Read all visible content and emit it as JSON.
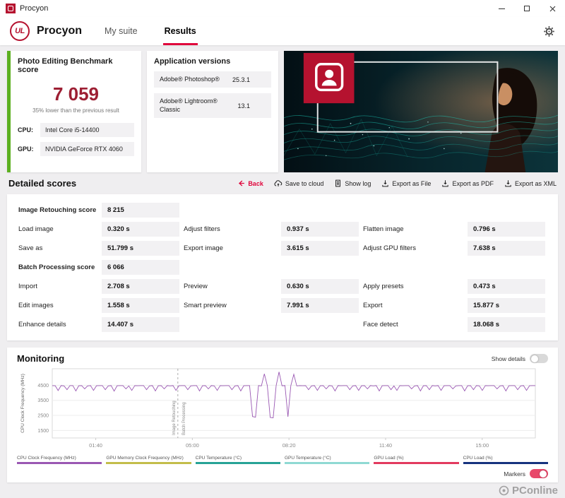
{
  "window": {
    "title": "Procyon"
  },
  "header": {
    "brand": "Procyon",
    "tabs": [
      {
        "label": "My suite",
        "active": false
      },
      {
        "label": "Results",
        "active": true
      }
    ]
  },
  "score_card": {
    "title": "Photo Editing Benchmark score",
    "score": "7 059",
    "comparison": "35% lower than the previous result",
    "accent_green": "#5cb020",
    "score_color": "#9d1f33",
    "specs": [
      {
        "label": "CPU:",
        "value": "Intel Core i5-14400"
      },
      {
        "label": "GPU:",
        "value": "NVIDIA GeForce RTX 4060"
      }
    ]
  },
  "app_versions": {
    "title": "Application versions",
    "rows": [
      {
        "name": "Adobe® Photoshop®",
        "version": "25.3.1"
      },
      {
        "name": "Adobe® Lightroom® Classic",
        "version": "13.1"
      }
    ]
  },
  "toolbar": {
    "section_title": "Detailed scores",
    "buttons": [
      {
        "label": "Back",
        "icon": "back-arrow-icon",
        "accent": true
      },
      {
        "label": "Save to cloud",
        "icon": "cloud-upload-icon",
        "accent": false
      },
      {
        "label": "Show log",
        "icon": "log-icon",
        "accent": false
      },
      {
        "label": "Export as File",
        "icon": "export-file-icon",
        "accent": false
      },
      {
        "label": "Export as PDF",
        "icon": "export-pdf-icon",
        "accent": false
      },
      {
        "label": "Export as XML",
        "icon": "export-xml-icon",
        "accent": false
      }
    ]
  },
  "detailed_scores": {
    "rows": [
      [
        {
          "label": "Image Retouching score",
          "value": "8 215",
          "bold": true
        },
        null,
        null
      ],
      [
        {
          "label": "Load image",
          "value": "0.320 s"
        },
        {
          "label": "Adjust filters",
          "value": "0.937 s"
        },
        {
          "label": "Flatten image",
          "value": "0.796 s"
        }
      ],
      [
        {
          "label": "Save as",
          "value": "51.799 s"
        },
        {
          "label": "Export image",
          "value": "3.615 s"
        },
        {
          "label": "Adjust GPU filters",
          "value": "7.638 s"
        }
      ],
      [
        {
          "label": "Batch Processing score",
          "value": "6 066",
          "bold": true
        },
        null,
        null
      ],
      [
        {
          "label": "Import",
          "value": "2.708 s"
        },
        {
          "label": "Preview",
          "value": "0.630 s"
        },
        {
          "label": "Apply presets",
          "value": "0.473 s"
        }
      ],
      [
        {
          "label": "Edit images",
          "value": "1.558 s"
        },
        {
          "label": "Smart preview",
          "value": "7.991 s"
        },
        {
          "label": "Export",
          "value": "15.877 s"
        }
      ],
      [
        {
          "label": "Enhance details",
          "value": "14.407 s"
        },
        null,
        {
          "label": "Face detect",
          "value": "18.068 s"
        }
      ]
    ]
  },
  "monitoring": {
    "title": "Monitoring",
    "show_details_label": "Show details",
    "show_details_on": false,
    "markers_label": "Markers",
    "markers_on": true,
    "legend": [
      {
        "label": "CPU Clock Frequency (MHz)",
        "color": "#9a58b3"
      },
      {
        "label": "GPU Memory Clock Frequency (MHz)",
        "color": "#c3bd4a"
      },
      {
        "label": "CPU Temperature (°C)",
        "color": "#27a396"
      },
      {
        "label": "GPU Temperature (°C)",
        "color": "#8fd9d3"
      },
      {
        "label": "GPU Load (%)",
        "color": "#e23a5f"
      },
      {
        "label": "CPU Load (%)",
        "color": "#16337e"
      }
    ]
  },
  "chart_data": {
    "type": "line",
    "title": "Monitoring",
    "ylabel": "CPU Clock Frequency (MHz)",
    "xlabel": "",
    "grid": true,
    "legend_position": "bottom",
    "x_ticks": [
      "01:40",
      "05:00",
      "08:20",
      "11:40",
      "15:00"
    ],
    "x_tick_positions": [
      0.09,
      0.29,
      0.49,
      0.69,
      0.89
    ],
    "y_ticks": [
      1500,
      2500,
      3500,
      4500
    ],
    "ylim": [
      1000,
      5600
    ],
    "markers": [
      {
        "position": 0.26,
        "left_label": "Image Retouching",
        "right_label": "Batch Processing"
      }
    ],
    "series": [
      {
        "name": "CPU Clock Frequency (MHz)",
        "color": "#9a58b3",
        "values": [
          4480,
          4470,
          4150,
          4480,
          4460,
          4210,
          4480,
          4480,
          4120,
          4470,
          4480,
          4260,
          4460,
          4480,
          4160,
          4470,
          4480,
          4480,
          4210,
          4460,
          4480,
          4110,
          4470,
          4480,
          4480,
          4260,
          4460,
          4160,
          4480,
          4470,
          4480,
          4480,
          4210,
          4460,
          4480,
          4120,
          4470,
          4480,
          4260,
          4480,
          4460,
          4480,
          4160,
          4470,
          4480,
          4480,
          4210,
          4460,
          4480,
          4480,
          4120,
          4470,
          4480,
          4260,
          4480,
          4460,
          4160,
          4480,
          4470,
          4480,
          4480,
          4210,
          4460,
          4480,
          4120,
          4470,
          4480,
          4480,
          2420,
          2380,
          4480,
          4460,
          5260,
          4480,
          2360,
          2340,
          4480,
          5390,
          4470,
          4480,
          2410,
          4480,
          5230,
          4460,
          4480,
          4470,
          4480,
          4210,
          4460,
          4480,
          4160,
          4470,
          4480,
          4260,
          4480,
          4460,
          4120,
          4480,
          4470,
          4480,
          4480,
          4210,
          4460,
          4480,
          4160,
          4470,
          4480,
          4260,
          4480,
          4460,
          4480,
          4120,
          4470,
          4480,
          4480,
          4210,
          4460,
          4160,
          4480,
          4470,
          4480,
          4480,
          4260,
          4460,
          4480,
          4120,
          4470,
          4480,
          4210,
          4480,
          4460,
          4480,
          4160,
          4470,
          4480,
          4480,
          4260,
          4460,
          4480,
          4480,
          4120,
          4470,
          4480,
          4210,
          4480,
          4460,
          4160,
          4480,
          4470,
          4480,
          4480,
          4260,
          4460,
          4480,
          4120,
          4470,
          4480,
          4480,
          4210,
          4460,
          4480,
          4160,
          4470,
          4480,
          4480
        ]
      }
    ]
  },
  "watermark": {
    "text": "PConline"
  }
}
